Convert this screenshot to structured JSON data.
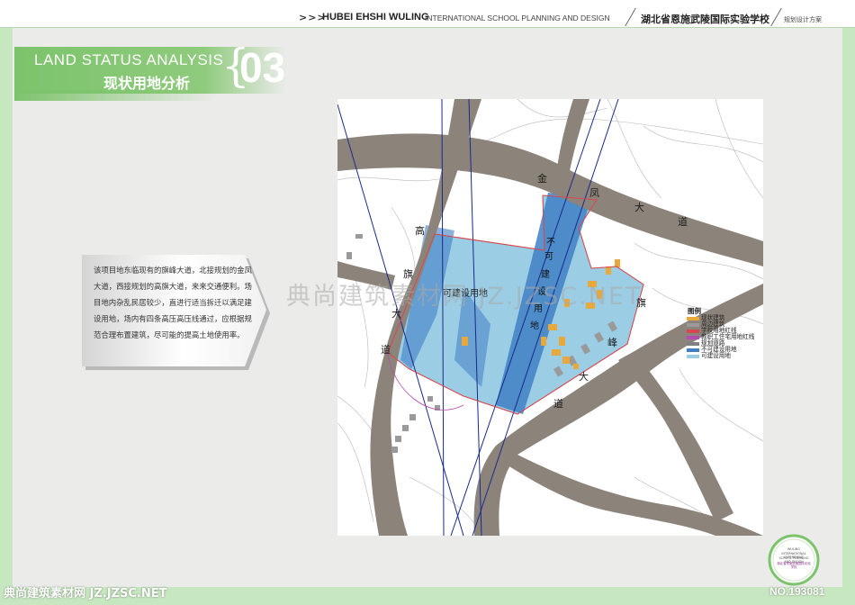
{
  "header": {
    "arrows": ">>>",
    "title": "HUBEI EHSHI WULING",
    "subtitle": "INTERNATIONAL SCHOOL PLANNING AND DESIGN",
    "school_cn": "湖北省恩施武陵国际实验学校",
    "right_label": "规划设计方案"
  },
  "section": {
    "title_en": "LAND STATUS ANALYSIS",
    "title_cn": "现状用地分析",
    "brace": "{",
    "number": "03"
  },
  "description": {
    "lines": [
      "该项目地东临现有的旗峰大道，北接规划的金凤",
      "大道，西接规划的高旗大道，来来交通便利。场",
      "目地内杂乱民居较少，直进行适当拆迁以满足建",
      "设用地，场内有四条高压高压线通过，应根据规",
      "范合理布置建筑，尽可能的提高土地使用率。"
    ]
  },
  "map": {
    "buildable_label": "可建设用地",
    "no_build_chars": [
      "不",
      "可",
      "建",
      "设",
      "用",
      "地"
    ],
    "road_jinfeng_chars": [
      "金",
      "凤",
      "大",
      "道"
    ],
    "road_gaoqi_chars": [
      "高",
      "旗",
      "大",
      "道"
    ],
    "road_qifeng_chars": [
      "旗",
      "峰",
      "大",
      "道"
    ]
  },
  "legend": {
    "title": "图例",
    "items": [
      {
        "label": "现状建筑",
        "color": "#e8a83a"
      },
      {
        "label": "周边建筑",
        "color": "#9a9a9a"
      },
      {
        "label": "学校用地红线",
        "color": "#d8474f"
      },
      {
        "label": "教职工住宅用地红线",
        "color": "#b44bb2"
      },
      {
        "label": "规划道路",
        "color": "#808080"
      },
      {
        "label": "不可建设用地",
        "color": "#3f7fc4"
      },
      {
        "label": "可建设用地",
        "color": "#9bcde5"
      }
    ]
  },
  "watermarks": {
    "center": "典尚建筑素材网 JZ.JZSC.NET",
    "bottom_left": "典尚建筑素材网 JZ.JZSC.NET",
    "bottom_right": "NO.193081"
  },
  "badge": {
    "lines": [
      "WULING",
      "INTERNATIONAL EXPERIMENT",
      "SCHOOL PLANNING AND DESIGN",
      "湖北省恩施武陵国际实验学校"
    ]
  },
  "colors": {
    "accent_green": "#7cc36b",
    "road_gray": "#8c847b",
    "buildable_blue": "#9bcde5",
    "no_build_blue": "#3f7fc4",
    "existing_building": "#e8a83a",
    "boundary_red": "#d8474f",
    "power_line": "#1a2a8a"
  }
}
